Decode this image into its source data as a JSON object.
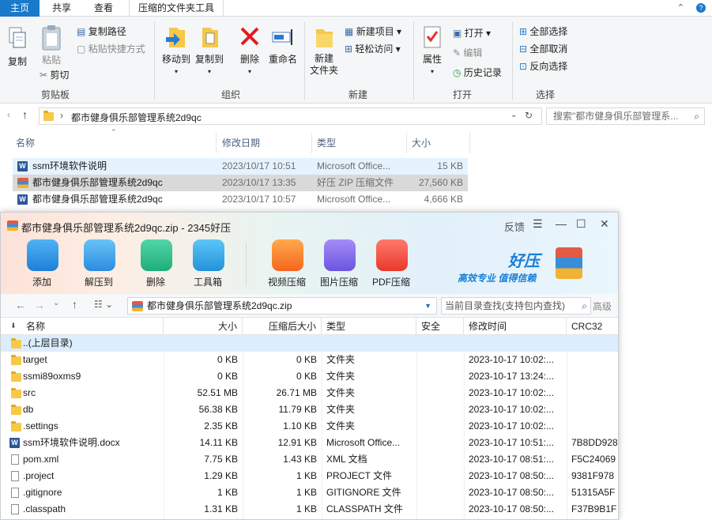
{
  "explorer": {
    "tabs": [
      "主页",
      "共享",
      "查看",
      "压缩的文件夹工具"
    ],
    "ribbon": {
      "clipboard": {
        "copy": "复制",
        "paste": "粘贴",
        "copy_path": "复制路径",
        "paste_shortcut": "粘贴快捷方式",
        "cut": "剪切",
        "group": "剪贴板"
      },
      "organize": {
        "move_to": "移动到",
        "copy_to": "复制到",
        "delete": "删除",
        "rename": "重命名",
        "group": "组织"
      },
      "new": {
        "new_folder_1": "新建",
        "new_folder_2": "文件夹",
        "new_item": "新建项目",
        "easy_access": "轻松访问",
        "group": "新建"
      },
      "open": {
        "properties": "属性",
        "open": "打开",
        "edit": "编辑",
        "history": "历史记录",
        "group": "打开"
      },
      "select": {
        "select_all": "全部选择",
        "select_none": "全部取消",
        "invert": "反向选择",
        "group": "选择"
      }
    },
    "address": {
      "path": "都市健身俱乐部管理系统2d9qc",
      "search_placeholder": "搜索\"都市健身俱乐部管理系..."
    },
    "columns": [
      "名称",
      "修改日期",
      "类型",
      "大小"
    ],
    "files": [
      {
        "name": "ssm环境软件说明",
        "date": "2023/10/17 10:51",
        "type": "Microsoft Office...",
        "size": "15 KB"
      },
      {
        "name": "都市健身俱乐部管理系统2d9qc",
        "date": "2023/10/17 13:35",
        "type": "好压 ZIP 压缩文件",
        "size": "27,560 KB"
      },
      {
        "name": "都市健身俱乐部管理系统2d9qc",
        "date": "2023/10/17 10:57",
        "type": "Microsoft Office...",
        "size": "4,666 KB"
      }
    ]
  },
  "zip": {
    "title": "都市健身俱乐部管理系统2d9qc.zip - 2345好压",
    "feedback": "反馈",
    "toolbar": [
      "添加",
      "解压到",
      "删除",
      "工具箱",
      "视频压缩",
      "图片压缩",
      "PDF压缩"
    ],
    "brand": {
      "name": "好压",
      "slogan": "高效专业 值得信赖"
    },
    "path": "都市健身俱乐部管理系统2d9qc.zip",
    "search_placeholder": "当前目录查找(支持包内查找)",
    "advanced": "高级",
    "columns": [
      "名称",
      "大小",
      "压缩后大小",
      "类型",
      "安全",
      "修改时间",
      "CRC32"
    ],
    "rows": [
      {
        "name": "..(上层目录)",
        "size": "",
        "packed": "",
        "type": "",
        "time": "",
        "crc": "",
        "icon": "folder"
      },
      {
        "name": "target",
        "size": "0 KB",
        "packed": "0 KB",
        "type": "文件夹",
        "time": "2023-10-17 10:02:...",
        "crc": "",
        "icon": "folder"
      },
      {
        "name": "ssmi89oxms9",
        "size": "0 KB",
        "packed": "0 KB",
        "type": "文件夹",
        "time": "2023-10-17 13:24:...",
        "crc": "",
        "icon": "folder"
      },
      {
        "name": "src",
        "size": "52.51 MB",
        "packed": "26.71 MB",
        "type": "文件夹",
        "time": "2023-10-17 10:02:...",
        "crc": "",
        "icon": "folder"
      },
      {
        "name": "db",
        "size": "56.38 KB",
        "packed": "11.79 KB",
        "type": "文件夹",
        "time": "2023-10-17 10:02:...",
        "crc": "",
        "icon": "folder"
      },
      {
        "name": ".settings",
        "size": "2.35 KB",
        "packed": "1.10 KB",
        "type": "文件夹",
        "time": "2023-10-17 10:02:...",
        "crc": "",
        "icon": "folder"
      },
      {
        "name": "ssm环境软件说明.docx",
        "size": "14.11 KB",
        "packed": "12.91 KB",
        "type": "Microsoft Office...",
        "time": "2023-10-17 10:51:...",
        "crc": "7B8DD928",
        "icon": "doc"
      },
      {
        "name": "pom.xml",
        "size": "7.75 KB",
        "packed": "1.43 KB",
        "type": "XML 文档",
        "time": "2023-10-17 08:51:...",
        "crc": "F5C24069",
        "icon": "file"
      },
      {
        "name": ".project",
        "size": "1.29 KB",
        "packed": "1 KB",
        "type": "PROJECT 文件",
        "time": "2023-10-17 08:50:...",
        "crc": "9381F978",
        "icon": "file"
      },
      {
        "name": ".gitignore",
        "size": "1 KB",
        "packed": "1 KB",
        "type": "GITIGNORE 文件",
        "time": "2023-10-17 08:50:...",
        "crc": "51315A5F",
        "icon": "file"
      },
      {
        "name": ".classpath",
        "size": "1.31 KB",
        "packed": "1 KB",
        "type": "CLASSPATH 文件",
        "time": "2023-10-17 08:50:...",
        "crc": "F37B9B1F",
        "icon": "file"
      }
    ]
  }
}
